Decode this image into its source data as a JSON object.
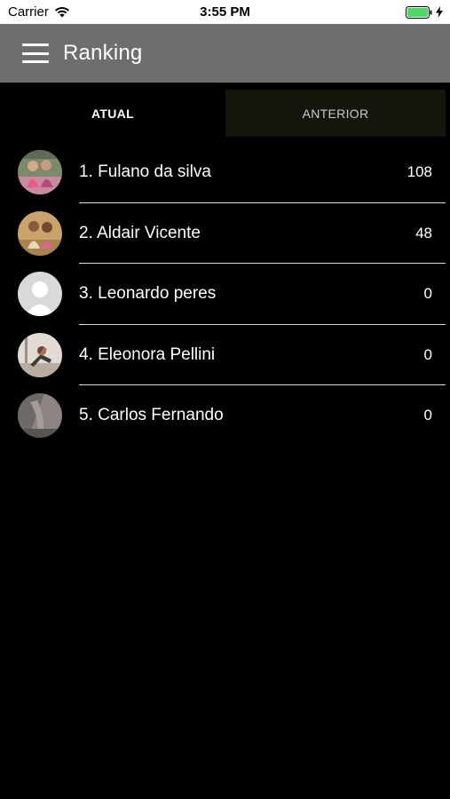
{
  "status_bar": {
    "carrier": "Carrier",
    "time": "3:55 PM",
    "wifi_icon": "wifi-icon",
    "battery_icon": "battery-charging-icon",
    "battery_color": "#4cd964"
  },
  "app_bar": {
    "menu_icon": "hamburger-menu-icon",
    "title": "Ranking",
    "background": "#6e6e6e"
  },
  "tabs": [
    {
      "label": "ATUAL",
      "selected": true
    },
    {
      "label": "ANTERIOR",
      "selected": false
    }
  ],
  "ranking": [
    {
      "name": "1. Fulano da silva",
      "score": "108",
      "avatar": "photo"
    },
    {
      "name": "2. Aldair Vicente",
      "score": "48",
      "avatar": "photo"
    },
    {
      "name": "3. Leonardo peres",
      "score": "0",
      "avatar": "default-user-placeholder"
    },
    {
      "name": "4. Eleonora Pellini",
      "score": "0",
      "avatar": "photo"
    },
    {
      "name": "5. Carlos Fernando",
      "score": "0",
      "avatar": "photo"
    }
  ]
}
